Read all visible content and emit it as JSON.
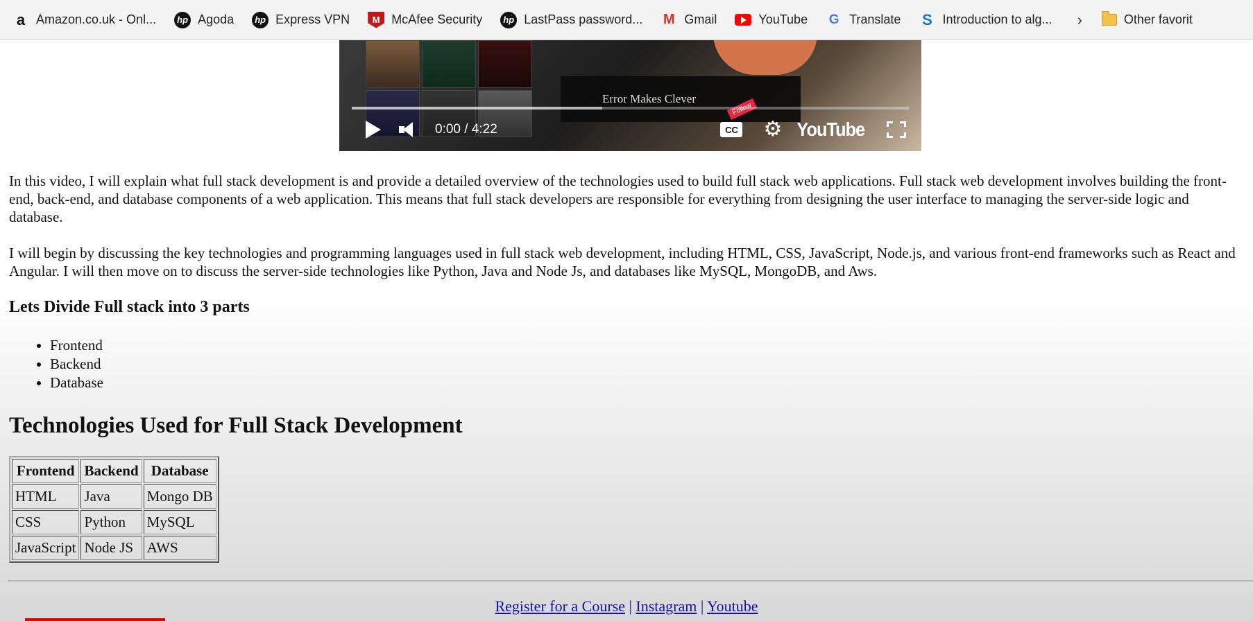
{
  "bookmarks": [
    {
      "label": "Amazon.co.uk - Onl...",
      "icon": "amazon-icon",
      "glyph": "a"
    },
    {
      "label": "Agoda",
      "icon": "hp-icon",
      "glyph": "hp"
    },
    {
      "label": "Express VPN",
      "icon": "hp-icon",
      "glyph": "hp"
    },
    {
      "label": "McAfee Security",
      "icon": "mcafee-icon",
      "glyph": "M"
    },
    {
      "label": "LastPass password...",
      "icon": "hp-icon",
      "glyph": "hp"
    },
    {
      "label": "Gmail",
      "icon": "gmail-icon",
      "glyph": "M"
    },
    {
      "label": "YouTube",
      "icon": "youtube-icon",
      "glyph": ""
    },
    {
      "label": "Translate",
      "icon": "translate-icon",
      "glyph": "G"
    },
    {
      "label": "Introduction to alg...",
      "icon": "intro-icon",
      "glyph": "S"
    }
  ],
  "bookmarks_overflow_glyph": "›",
  "other_favorites": "Other favorit",
  "video": {
    "channel_name": "Error Makes Clever",
    "follow_badge": "Follow",
    "time": "0:00 / 4:22",
    "cc_label": "CC",
    "gear_glyph": "⚙",
    "logo_text": "YouTube",
    "progress_buffer_fraction": 0.45
  },
  "article": {
    "para1": "In this video, I will explain what full stack development is and provide a detailed overview of the technologies used to build full stack web applications. Full stack web development involves building the front-end, back-end, and database components of a web application. This means that full stack developers are responsible for everything from designing the user interface to managing the server-side logic and database.",
    "para2": "I will begin by discussing the key technologies and programming languages used in full stack web development, including HTML, CSS, JavaScript, Node.js, and various front-end frameworks such as React and Angular. I will then move on to discuss the server-side technologies like Python, Java and Node Js, and databases like MySQL, MongoDB, and Aws.",
    "divide_heading": "Lets Divide Full stack into 3 parts",
    "parts": [
      "Frontend",
      "Backend",
      "Database"
    ],
    "tech_heading": "Technologies Used for Full Stack Development",
    "table": {
      "headers": [
        "Frontend",
        "Backend",
        "Database"
      ],
      "rows": [
        [
          "HTML",
          "Java",
          "Mongo DB"
        ],
        [
          "CSS",
          "Python",
          "MySQL"
        ],
        [
          "JavaScript",
          "Node JS",
          "AWS"
        ]
      ]
    }
  },
  "footer": {
    "links": [
      "Register for a Course",
      "Instagram",
      "Youtube"
    ],
    "separator": "|"
  }
}
